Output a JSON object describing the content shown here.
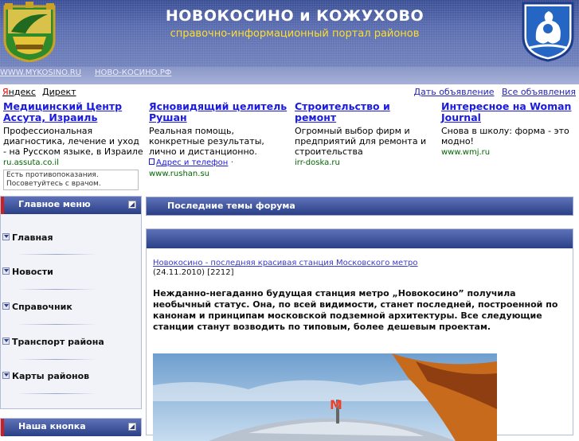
{
  "header": {
    "title": "НОВОКОСИНО и КОЖУХОВО",
    "subtitle": "справочно-информационный портал районов"
  },
  "linkbar": {
    "links": [
      "WWW.MYKOSINO.RU",
      "НОВО-КОСИНО.РФ"
    ]
  },
  "yandex_bar": {
    "yandex_first": "Я",
    "yandex_rest": "ндекс",
    "direct": "Директ",
    "right_links": [
      "Дать объявление",
      "Все объявления"
    ]
  },
  "ads": [
    {
      "title": "Медицинский Центр Ассута, Израиль",
      "text": "Профессиональная диагностика, лечение и уход - на Русском языке, в Израиле",
      "url": "ru.assuta.co.il",
      "warning": "Есть противопоказания. Посоветуйтесь с врачом."
    },
    {
      "title": "Ясновидящий целитель Рушан",
      "text": "Реальная помощь, конкретные результаты, лично и дистанционно.",
      "contact": "Адрес и телефон",
      "url": "www.rushan.su"
    },
    {
      "title": "Строительство и ремонт",
      "text": "Огромный выбор фирм и предприятий для ремонта и строительства",
      "url": "irr-doska.ru"
    },
    {
      "title": "Интересное на Woman Journal",
      "text": "Снова в школу: форма - это модно!",
      "url": "www.wmj.ru"
    }
  ],
  "left_menu": {
    "title": "Главное меню",
    "items": [
      "Главная",
      "Новости",
      "Справочник",
      "Транспорт района",
      "Карты районов"
    ]
  },
  "left_panel2": {
    "title": "Наша кнопка"
  },
  "forum": {
    "title": "Последние темы форума"
  },
  "article": {
    "link": "Новокосино - последняя красивая станция Московского метро",
    "meta": "(24.11.2010) [2212]",
    "body": "Нежданно-негаданно будущая станция метро  „Новокосино” получила необычный статус. Она, по всей видимости, станет последней, построенной по канонам и принципам московской подземной архитектуры. Все следующие станции станут возводить по типовым, более дешевым проектам.",
    "photo_sign": "М"
  },
  "colors": {
    "header_blue": "#3b4f95",
    "panel_blue": "#2b3f86",
    "subtitle_yellow": "#ffdf2a",
    "link_blue": "#1a1ae0",
    "url_green": "#006600"
  }
}
